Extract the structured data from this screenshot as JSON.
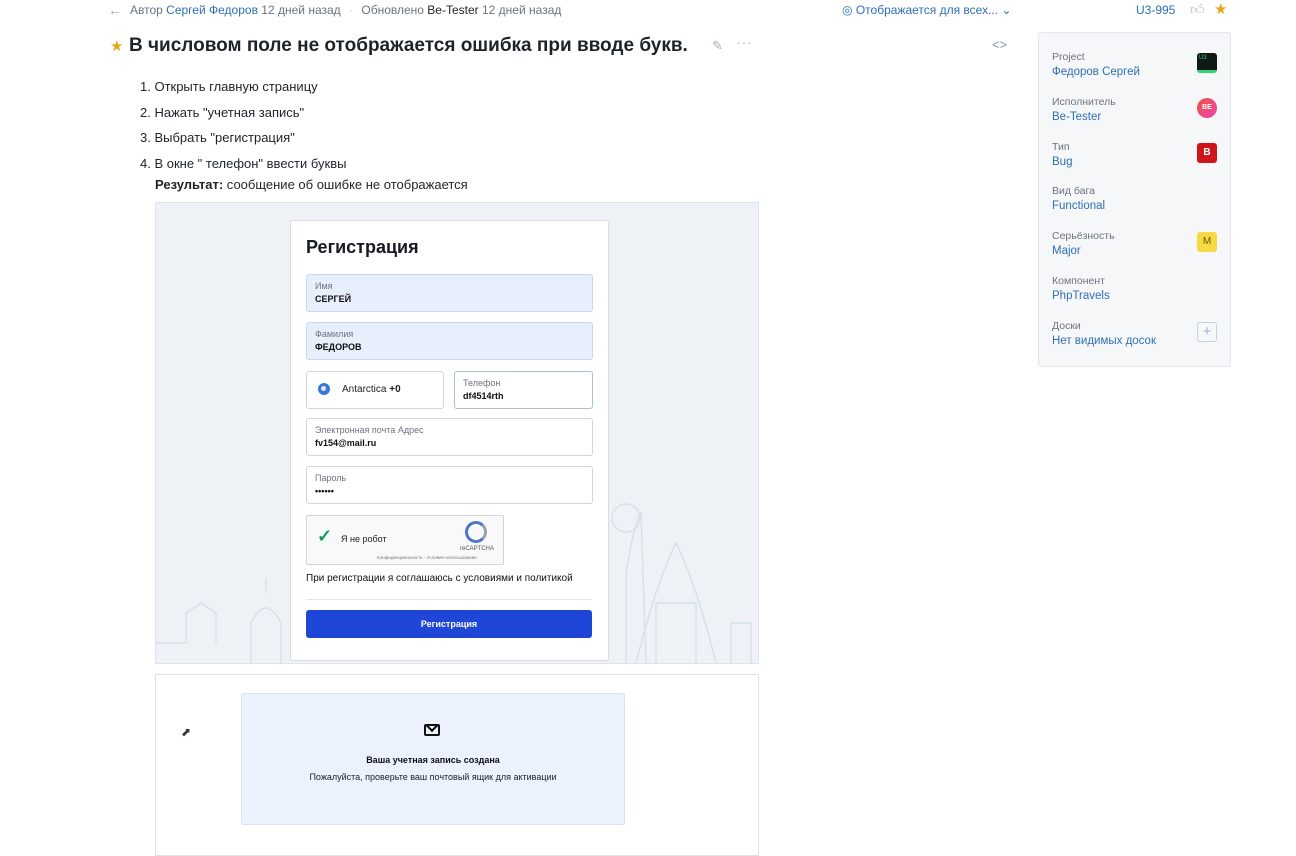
{
  "topbar": {
    "author_label": "Автор",
    "author_name": "Сергей Федоров",
    "author_time": "12 дней назад",
    "updated_label": "Обновлено",
    "updated_name": "Be-Tester",
    "updated_time": "12 дней назад",
    "visibility": "Отображается для всех...",
    "issue_key": "U3-995"
  },
  "issue": {
    "title": "В числовом поле не отображается ошибка при вводе букв.",
    "steps": [
      "1. Открыть главную страницу",
      "2. Нажать \"учетная запись\"",
      "3. Выбрать \"регистрация\"",
      "4. В окне \" телефон\" ввести буквы"
    ],
    "result_label": "Результат:",
    "result_text": " сообщение об ошибке не отображается"
  },
  "screenshot1": {
    "form_title": "Регистрация",
    "first_name_label": "Имя",
    "first_name_value": "СЕРГЕЙ",
    "last_name_label": "Фамилия",
    "last_name_value": "ФЕДОРОВ",
    "country_name": "Antarctica",
    "country_code": "+0",
    "phone_label": "Телефон",
    "phone_value": "df4514rth",
    "email_label": "Электронная почта Адрес",
    "email_value": "fv154@mail.ru",
    "password_label": "Пароль",
    "password_value": "••••••",
    "captcha_text": "Я не робот",
    "captcha_brand": "reCAPTCHA",
    "captcha_terms": "Конфиденциальность - Условия использования",
    "agree_text": "При регистрации я соглашаюсь с условиями и политикой",
    "submit_label": "Регистрация"
  },
  "screenshot2": {
    "success_title": "Ваша учетная запись создана",
    "success_text": "Пожалуйста, проверьте ваш почтовый ящик для активации"
  },
  "sidebar": {
    "fields": [
      {
        "label": "Project",
        "value": "Федоров Сергей",
        "badge": "U3"
      },
      {
        "label": "Исполнитель",
        "value": "Be-Tester",
        "badge": "BE"
      },
      {
        "label": "Тип",
        "value": "Bug",
        "badge": "B"
      },
      {
        "label": "Вид бага",
        "value": "Functional"
      },
      {
        "label": "Серьёзность",
        "value": "Major",
        "badge": "M"
      },
      {
        "label": "Компонент",
        "value": "PhpTravels"
      },
      {
        "label": "Доски",
        "value": "Нет видимых досок",
        "badge": "+"
      }
    ]
  },
  "colors": {
    "link": "#2f6fb3",
    "star": "#e8a317",
    "submit": "#2046d8",
    "bug_badge": "#d0141b",
    "severity_badge": "#f6d943"
  },
  "icons": [
    "back-arrow-icon",
    "eye-icon",
    "chevron-down-icon",
    "thumbs-up-icon",
    "star-icon",
    "pencil-icon",
    "more-icon",
    "code-icon",
    "globe-icon",
    "check-icon",
    "recaptcha-icon",
    "mail-icon",
    "cursor-icon",
    "plus-icon"
  ]
}
